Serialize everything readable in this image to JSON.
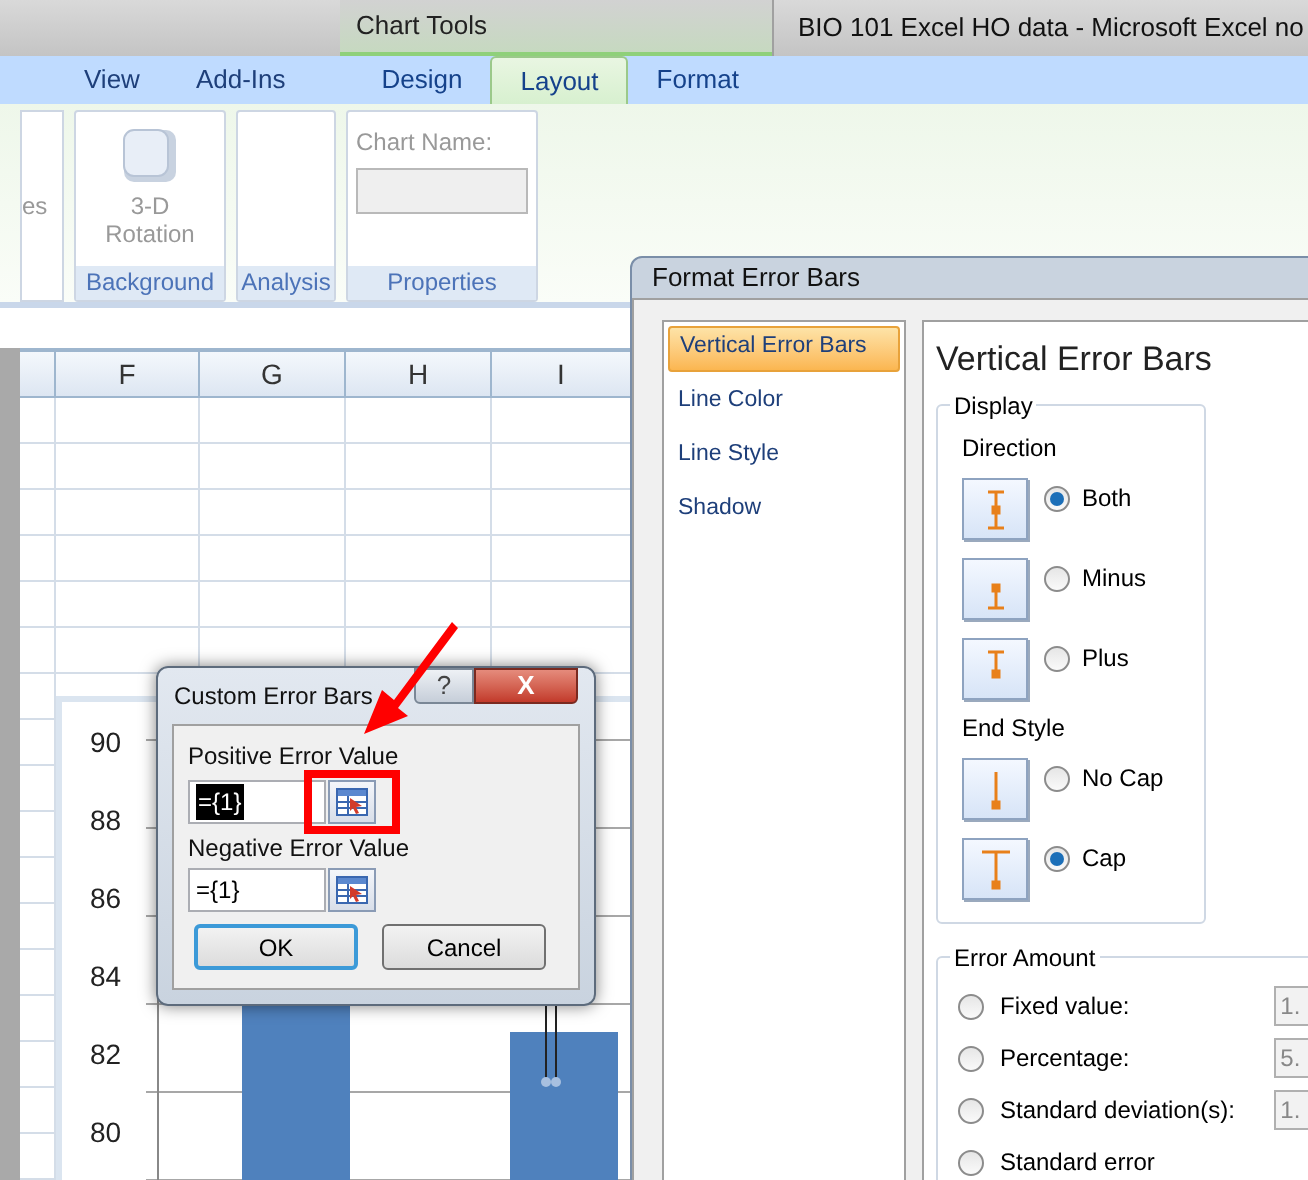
{
  "title_bar": {
    "contextual_label": "Chart Tools",
    "title": "BIO 101 Excel HO data - Microsoft Excel no"
  },
  "tabs": [
    {
      "label": "View",
      "selected": false,
      "contextual": false
    },
    {
      "label": "Add-Ins",
      "selected": false,
      "contextual": false
    },
    {
      "label": "Design",
      "selected": false,
      "contextual": true
    },
    {
      "label": "Layout",
      "selected": true,
      "contextual": true
    },
    {
      "label": "Format",
      "selected": false,
      "contextual": true
    }
  ],
  "ribbon": {
    "cut_label": "es",
    "groups": [
      {
        "name": "Background",
        "button": "3-D Rotation"
      },
      {
        "name": "Analysis"
      },
      {
        "name": "Properties",
        "field_label": "Chart Name:"
      }
    ]
  },
  "sheet": {
    "columns": [
      "F",
      "G",
      "H",
      "I"
    ]
  },
  "chart": {
    "y_labels": [
      "90",
      "88",
      "86",
      "84",
      "82",
      "80"
    ]
  },
  "format_dialog": {
    "title": "Format Error Bars",
    "nav": [
      {
        "label": "Vertical Error Bars",
        "selected": true
      },
      {
        "label": "Line Color",
        "selected": false
      },
      {
        "label": "Line Style",
        "selected": false
      },
      {
        "label": "Shadow",
        "selected": false
      }
    ],
    "heading": "Vertical Error Bars",
    "display_group": "Display",
    "direction_label": "Direction",
    "direction": [
      {
        "label": "Both",
        "kind": "both",
        "selected": true
      },
      {
        "label": "Minus",
        "kind": "minus",
        "selected": false
      },
      {
        "label": "Plus",
        "kind": "plus",
        "selected": false
      }
    ],
    "end_style_label": "End Style",
    "end_style": [
      {
        "label": "No Cap",
        "kind": "nocap",
        "selected": false
      },
      {
        "label": "Cap",
        "kind": "cap",
        "selected": true
      }
    ],
    "amount_group": "Error Amount",
    "amount": [
      {
        "label": "Fixed value:",
        "value": "1.",
        "selected": false
      },
      {
        "label": "Percentage:",
        "value": "5.",
        "selected": false
      },
      {
        "label": "Standard deviation(s):",
        "value": "1.",
        "selected": false
      },
      {
        "label": "Standard error",
        "selected": false
      }
    ]
  },
  "custom_dialog": {
    "title": "Custom Error Bars",
    "help": "?",
    "close": "X",
    "positive_label": "Positive Error Value",
    "positive_value": "={1}",
    "negative_label": "Negative Error Value",
    "negative_value": "={1}",
    "ok": "OK",
    "cancel": "Cancel"
  }
}
